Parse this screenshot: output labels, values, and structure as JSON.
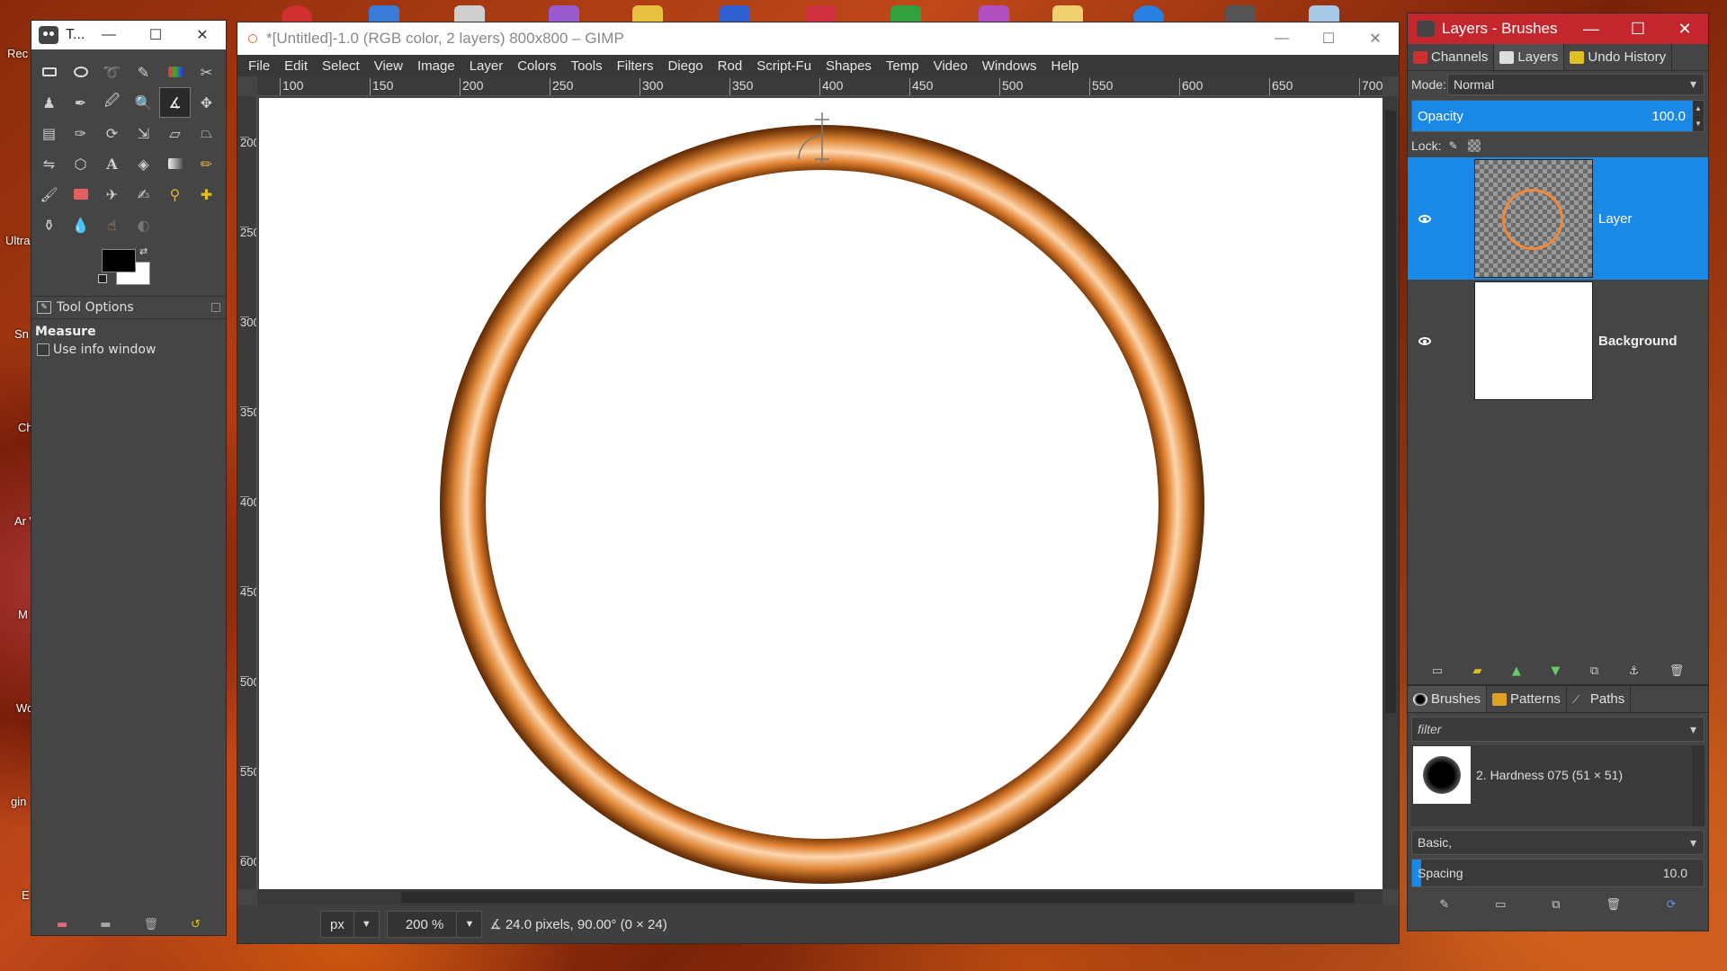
{
  "desktop": {
    "labels": [
      "Rec",
      "Ultra",
      "Sn",
      "Ch",
      "Ar W",
      "M",
      "Wo T",
      "gin",
      "E"
    ]
  },
  "toolbox": {
    "title": "T...",
    "controls": [
      "—",
      "☐",
      "✕"
    ],
    "tool_options": {
      "header": "Tool Options",
      "tool_name": "Measure",
      "checkbox_label": "Use info window",
      "checked": false
    }
  },
  "image_window": {
    "title": "*[Untitled]-1.0 (RGB color, 2 layers) 800x800 – GIMP",
    "controls": [
      "—",
      "☐",
      "✕"
    ],
    "menu": [
      "File",
      "Edit",
      "Select",
      "View",
      "Image",
      "Layer",
      "Colors",
      "Tools",
      "Filters",
      "Diego",
      "Rod",
      "Script-Fu",
      "Shapes",
      "Temp",
      "Video",
      "Windows",
      "Help"
    ],
    "ruler_h": [
      "100",
      "150",
      "200",
      "250",
      "300",
      "350",
      "400",
      "450",
      "500",
      "550",
      "600",
      "650",
      "700"
    ],
    "ruler_v": [
      "200",
      "250",
      "300",
      "350",
      "400",
      "450",
      "500",
      "550",
      "600"
    ],
    "status": {
      "unit": "px",
      "zoom": "200 %",
      "message": "24.0 pixels, 90.00° (0 × 24)"
    }
  },
  "layers_dock": {
    "title": "Layers - Brushes",
    "controls": [
      "—",
      "☐",
      "✕"
    ],
    "tabs": [
      "Channels",
      "Layers",
      "Undo History"
    ],
    "mode_label": "Mode:",
    "mode_value": "Normal",
    "opacity_label": "Opacity",
    "opacity_value": "100.0",
    "lock_label": "Lock:",
    "layers": [
      {
        "name": "Layer",
        "selected": true,
        "visible": true
      },
      {
        "name": "Background",
        "selected": false,
        "visible": true
      }
    ],
    "brush_tabs": [
      "Brushes",
      "Patterns",
      "Paths"
    ],
    "filter_placeholder": "filter",
    "brush_name": "2. Hardness 075 (51 × 51)",
    "brush_set": "Basic,",
    "spacing_label": "Spacing",
    "spacing_value": "10.0",
    "spacing_fraction": 0.01
  },
  "colors": {
    "accent": "#1a88e6",
    "ring_outer": "#8a4a14",
    "ring_highlight": "#fdd7b0",
    "title_red": "#c4262e"
  }
}
